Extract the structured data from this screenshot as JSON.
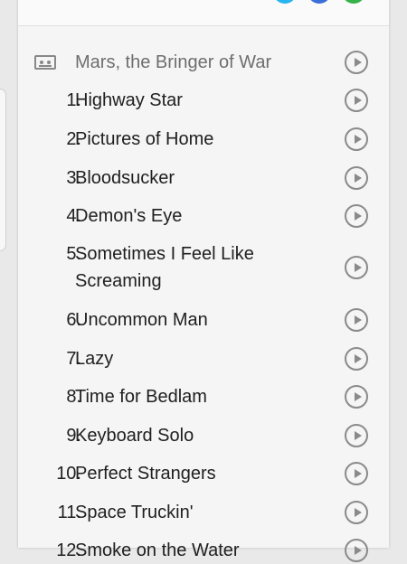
{
  "share": {
    "icons": [
      "twitter-icon",
      "facebook-icon",
      "whatsapp-icon"
    ],
    "colors": {
      "twitter": "#28b4ef",
      "facebook": "#3a6fd8",
      "whatsapp": "#36b24a"
    }
  },
  "album": {
    "title": "Mars, the Bringer of War",
    "icon": "cassette-icon"
  },
  "tracks": [
    {
      "number": "1.",
      "title": "Highway Star"
    },
    {
      "number": "2.",
      "title": "Pictures of Home"
    },
    {
      "number": "3.",
      "title": "Bloodsucker"
    },
    {
      "number": "4.",
      "title": "Demon's Eye"
    },
    {
      "number": "5.",
      "title": "Sometimes I Feel Like Screaming"
    },
    {
      "number": "6.",
      "title": "Uncommon Man"
    },
    {
      "number": "7.",
      "title": "Lazy"
    },
    {
      "number": "8.",
      "title": "Time for Bedlam"
    },
    {
      "number": "9.",
      "title": "Keyboard Solo"
    },
    {
      "number": "10.",
      "title": "Perfect Strangers"
    },
    {
      "number": "11.",
      "title": "Space Truckin'"
    },
    {
      "number": "12.",
      "title": "Smoke on the Water"
    }
  ]
}
